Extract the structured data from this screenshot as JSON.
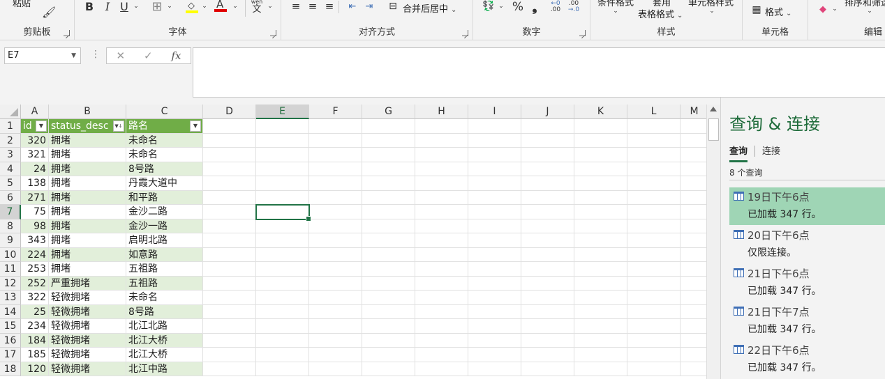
{
  "ribbon": {
    "paste_label": "粘贴",
    "groups": {
      "clipboard": "剪贴板",
      "font": "字体",
      "alignment": "对齐方式",
      "number": "数字",
      "styles": "样式",
      "cells": "单元格",
      "editing": "编辑"
    },
    "font_buttons": {
      "bold": "B",
      "italic": "I",
      "underline": "U",
      "wen": "文"
    },
    "merge_center": "合并后居中",
    "percent": "%",
    "comma": "❟",
    "conditional_format": "条件格式",
    "format_as_table_top": "套用",
    "format_as_table": "表格格式",
    "cell_styles": "单元格样式",
    "format": "格式",
    "sort_filter": "排序和筛选"
  },
  "formula_bar": {
    "name_box": "E7",
    "cancel": "✕",
    "enter": "✓",
    "fx": "fx",
    "value": ""
  },
  "grid": {
    "columns": [
      "A",
      "B",
      "C",
      "D",
      "E",
      "F",
      "G",
      "H",
      "I",
      "J",
      "K",
      "L",
      "M"
    ],
    "selected_column": "E",
    "selected_row": 7,
    "header": [
      "id",
      "status_desc",
      "路名"
    ],
    "rows": [
      [
        "320",
        "拥堵",
        "未命名"
      ],
      [
        "321",
        "拥堵",
        "未命名"
      ],
      [
        "24",
        "拥堵",
        "8号路"
      ],
      [
        "138",
        "拥堵",
        "丹霞大道中"
      ],
      [
        "271",
        "拥堵",
        "和平路"
      ],
      [
        "75",
        "拥堵",
        "金沙二路"
      ],
      [
        "98",
        "拥堵",
        "金沙一路"
      ],
      [
        "343",
        "拥堵",
        "启明北路"
      ],
      [
        "224",
        "拥堵",
        "如意路"
      ],
      [
        "253",
        "拥堵",
        "五祖路"
      ],
      [
        "252",
        "严重拥堵",
        "五祖路"
      ],
      [
        "322",
        "轻微拥堵",
        "未命名"
      ],
      [
        "25",
        "轻微拥堵",
        "8号路"
      ],
      [
        "234",
        "轻微拥堵",
        "北江北路"
      ],
      [
        "184",
        "轻微拥堵",
        "北江大桥"
      ],
      [
        "185",
        "轻微拥堵",
        "北江大桥"
      ],
      [
        "120",
        "轻微拥堵",
        "北江中路"
      ]
    ]
  },
  "pane": {
    "title": "查询 & 连接",
    "tab_queries": "查询",
    "tab_connections": "连接",
    "count": "8 个查询",
    "queries": [
      {
        "name": "19日下午6点",
        "status": "已加载 347 行。",
        "active": true
      },
      {
        "name": "20日下午6点",
        "status": "仅限连接。",
        "active": false
      },
      {
        "name": "21日下午6点",
        "status": "已加载 347 行。",
        "active": false
      },
      {
        "name": "21日下午7点",
        "status": "已加载 347 行。",
        "active": false
      },
      {
        "name": "22日下午6点",
        "status": "已加载 347 行。",
        "active": false
      }
    ]
  },
  "colors": {
    "accent": "#217346",
    "table_header": "#70ad47",
    "band": "#e2efda",
    "query_active": "#9fd5b5"
  }
}
